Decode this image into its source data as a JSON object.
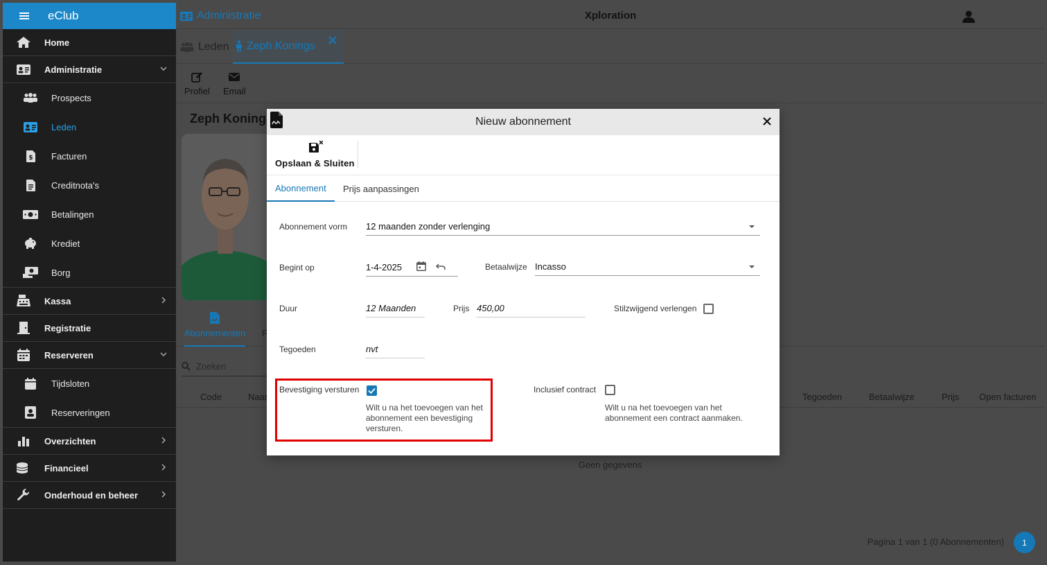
{
  "sidebar": {
    "brand": "eClub",
    "items": [
      {
        "label": "Home"
      },
      {
        "label": "Administratie"
      },
      {
        "label": "Kassa"
      },
      {
        "label": "Registratie"
      },
      {
        "label": "Reserveren"
      },
      {
        "label": "Overzichten"
      },
      {
        "label": "Financieel"
      },
      {
        "label": "Onderhoud en beheer"
      }
    ],
    "admin_sub": [
      {
        "label": "Prospects"
      },
      {
        "label": "Leden"
      },
      {
        "label": "Facturen"
      },
      {
        "label": "Creditnota's"
      },
      {
        "label": "Betalingen"
      },
      {
        "label": "Krediet"
      },
      {
        "label": "Borg"
      }
    ],
    "reserveren_sub": [
      {
        "label": "Tijdsloten"
      },
      {
        "label": "Reserveringen"
      }
    ],
    "active_color": "#2aa0e6"
  },
  "topbar": {
    "breadcrumb": "Administratie",
    "app_title": "Xploration"
  },
  "page_tabs": {
    "leden": "Leden",
    "member": "Zeph Konings"
  },
  "toolbar": {
    "profiel": "Profiel",
    "email": "Email"
  },
  "member": {
    "name": "Zeph Konings"
  },
  "subtabs": {
    "abonnementen": "Abonnementen",
    "f": "F"
  },
  "search": {
    "placeholder": "Zoeken"
  },
  "table": {
    "headers": {
      "code": "Code",
      "naam": "Naam",
      "tegoeden": "Tegoeden",
      "betaalwijze": "Betaalwijze",
      "prijs": "Prijs",
      "open_facturen": "Open facturen"
    },
    "empty": "Geen gegevens",
    "paging": "Pagina 1 van 1 (0 Abonnementen)",
    "page": "1"
  },
  "modal": {
    "title": "Nieuw abonnement",
    "save_label": "Opslaan & Sluiten",
    "tabs": {
      "abonnement": "Abonnement",
      "prijs": "Prijs aanpassingen"
    },
    "form": {
      "vorm_label": "Abonnement vorm",
      "vorm_value": "12 maanden zonder verlenging",
      "begint_label": "Begint op",
      "begint_value": "1-4-2025",
      "betaalwijze_label": "Betaalwijze",
      "betaalwijze_value": "Incasso",
      "duur_label": "Duur",
      "duur_value": "12 Maanden",
      "prijs_label": "Prijs",
      "prijs_value": "450,00",
      "stilzwijgend_label": "Stilzwijgend verlengen",
      "stilzwijgend_checked": false,
      "tegoeden_label": "Tegoeden",
      "tegoeden_value": "nvt",
      "bevestiging_label": "Bevestiging versturen",
      "bevestiging_checked": true,
      "bevestiging_hint_1": "Wilt u na het toevoegen van het",
      "bevestiging_hint_2": "abonnement een bevestiging",
      "bevestiging_hint_3": "versturen.",
      "contract_label": "Inclusief contract",
      "contract_checked": false,
      "contract_hint_1": "Wilt u na het toevoegen van het",
      "contract_hint_2": "abonnement een contract aanmaken."
    },
    "accent": "#1679b7",
    "highlight_color": "#e00000"
  }
}
